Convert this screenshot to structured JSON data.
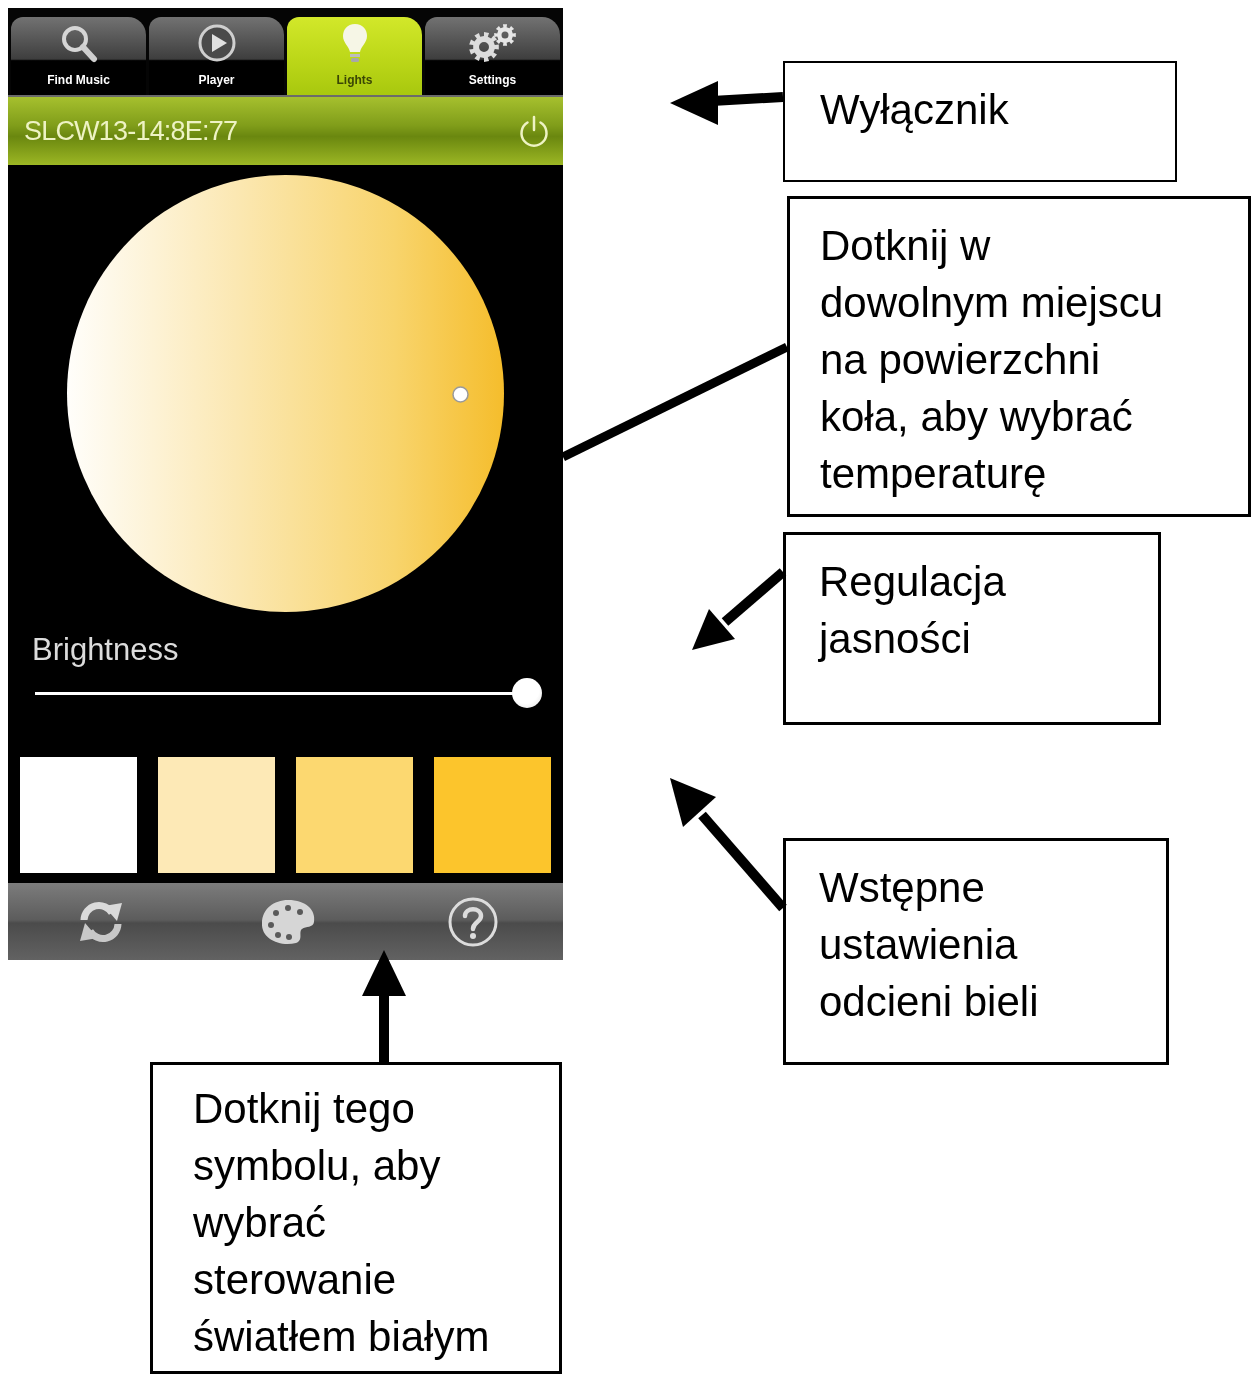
{
  "app": {
    "tabs": [
      {
        "label": "Find Music",
        "selected": false
      },
      {
        "label": "Player",
        "selected": false
      },
      {
        "label": "Lights",
        "selected": true
      },
      {
        "label": "Settings",
        "selected": false
      }
    ],
    "device": {
      "name": "SLCW13-14:8E:77"
    },
    "brightness": {
      "label": "Brightness",
      "level": 1
    },
    "presets": [
      {
        "color": "#ffffff"
      },
      {
        "color": "#fde9b6"
      },
      {
        "color": "#fcd870"
      },
      {
        "color": "#fcc52c"
      }
    ]
  },
  "callouts": [
    {
      "text": "Wyłącznik"
    },
    {
      "text": "Dotknij w dowolnym miejscu na powierzchni koła, aby wybrać temperaturę"
    },
    {
      "text": "Regulacja jasności"
    },
    {
      "text": "Wstępne ustawienia odcieni bieli"
    },
    {
      "text": "Dotknij tego symbolu, aby wybrać sterowanie światłem białym"
    }
  ]
}
